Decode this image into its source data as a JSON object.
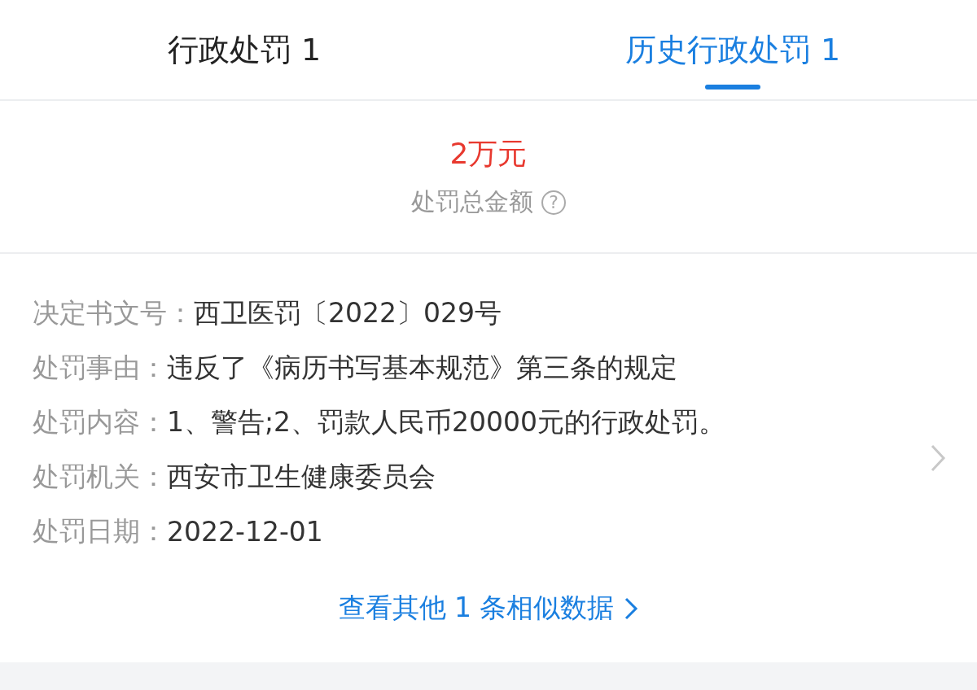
{
  "tabs": [
    {
      "label": "行政处罚 1",
      "selected": false
    },
    {
      "label": "历史行政处罚 1",
      "selected": true
    }
  ],
  "summary": {
    "amount": "2万元",
    "label": "处罚总金额",
    "help": "?"
  },
  "details": [
    {
      "label": "决定书文号：",
      "value": "西卫医罚〔2022〕029号"
    },
    {
      "label": "处罚事由：",
      "value": "违反了《病历书写基本规范》第三条的规定"
    },
    {
      "label": "处罚内容：",
      "value": "1、警告;2、罚款人民币20000元的行政处罚。"
    },
    {
      "label": "处罚机关：",
      "value": "西安市卫生健康委员会"
    },
    {
      "label": "处罚日期：",
      "value": "2022-12-01"
    }
  ],
  "more_link": "查看其他 1 条相似数据"
}
